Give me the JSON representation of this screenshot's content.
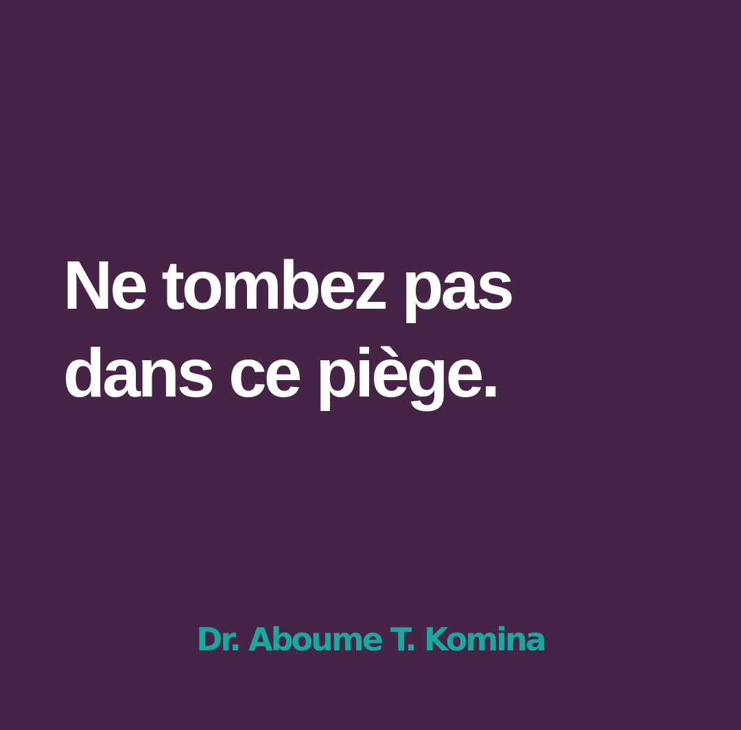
{
  "slide": {
    "headline": {
      "line_1": "Ne tombez pas",
      "line_2": "dans ce piège."
    },
    "author": "Dr. Aboume T. Komina"
  },
  "colors": {
    "background": "#452445",
    "headline": "#ffffff",
    "author": "#19a8a0"
  }
}
